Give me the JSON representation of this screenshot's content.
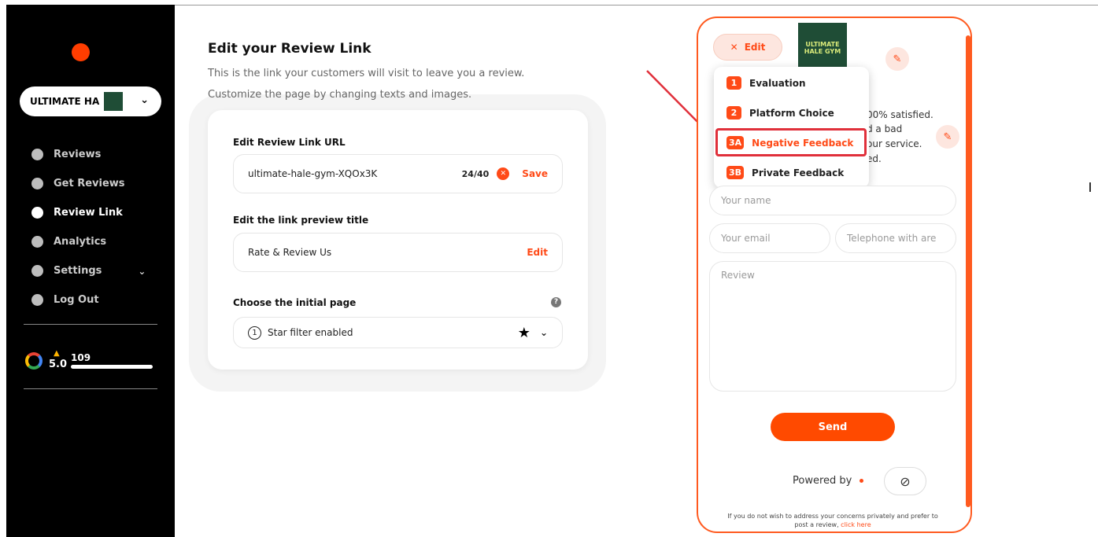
{
  "sidebar": {
    "account_name": "ULTIMATE HA",
    "account_thumb_text": "ULTIMATE HALE GYM",
    "items": [
      {
        "label": "Reviews",
        "icon": "star-icon"
      },
      {
        "label": "Get Reviews",
        "icon": "plus-icon"
      },
      {
        "label": "Review Link",
        "icon": "chat-icon"
      },
      {
        "label": "Analytics",
        "icon": "analytics-icon"
      },
      {
        "label": "Settings",
        "icon": "gear-icon"
      },
      {
        "label": "Log Out",
        "icon": "logout-icon"
      }
    ],
    "google": {
      "rating": "5.0",
      "count": "109"
    }
  },
  "main": {
    "title": "Edit your Review Link",
    "subtitle1": "This is the link your customers will visit to leave you a review.",
    "subtitle2": "Customize the page by changing texts and images.",
    "url_section": {
      "label": "Edit Review Link URL",
      "value": "ultimate-hale-gym-XQOx3K",
      "counter": "24/40",
      "action": "Save"
    },
    "title_section": {
      "label": "Edit the link preview title",
      "value": "Rate & Review Us",
      "action": "Edit"
    },
    "initial_section": {
      "label": "Choose the initial page",
      "help": "?",
      "number": "1",
      "value": "Star filter enabled"
    }
  },
  "preview": {
    "edit_button": "Edit",
    "logo_line1": "ULTIMATE",
    "logo_line2": "HALE GYM",
    "bg_lines": [
      "00% satisfied.",
      "d a bad",
      "our service.",
      "ed."
    ],
    "menu": [
      {
        "num": "1",
        "label": "Evaluation"
      },
      {
        "num": "2",
        "label": "Platform Choice"
      },
      {
        "num": "3A",
        "label": "Negative Feedback"
      },
      {
        "num": "3B",
        "label": "Private Feedback"
      }
    ],
    "name_placeholder": "Your name",
    "email_placeholder": "Your email",
    "phone_placeholder": "Telephone with are",
    "review_placeholder": "Review",
    "send_label": "Send",
    "powered_by": "Powered by",
    "footnote_text": "If you do not wish to address your concerns privately and prefer to post a review,",
    "footnote_link": "click here"
  },
  "colors": {
    "accent": "#ff4a17",
    "sidebar": "#000000",
    "logo_bg": "#1f4d36",
    "highlight": "#e0303b"
  }
}
